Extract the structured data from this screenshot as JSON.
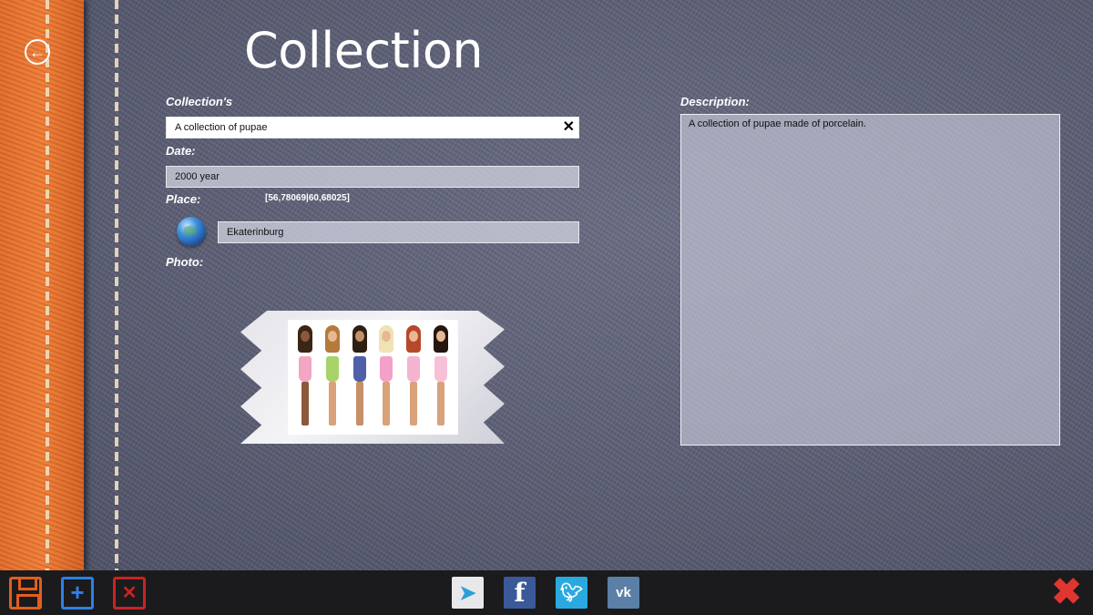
{
  "page": {
    "title": "Collection"
  },
  "form": {
    "name_label": "Collection's",
    "name_value": "A collection of pupae",
    "date_label": "Date:",
    "date_value": "2000 year",
    "place_label": "Place:",
    "place_coords": "[56,78069|60,68025]",
    "place_value": "Ekaterinburg",
    "photo_label": "Photo:",
    "description_label": "Description:",
    "description_value": "A collection of pupae made of porcelain."
  },
  "app_bar": {
    "left_buttons": [
      "save-icon",
      "add-icon",
      "delete-icon"
    ],
    "social_buttons": [
      "telegram-icon",
      "facebook-icon",
      "twitter-icon",
      "vk-icon"
    ],
    "close_icon": "close-icon"
  },
  "colors": {
    "save": "#e25e1d",
    "add": "#2f7fe8",
    "delete": "#cc2222",
    "close": "#e0362f",
    "facebook": "#3b5998",
    "twitter": "#2aa9e0",
    "vk": "#5b7fa6"
  }
}
